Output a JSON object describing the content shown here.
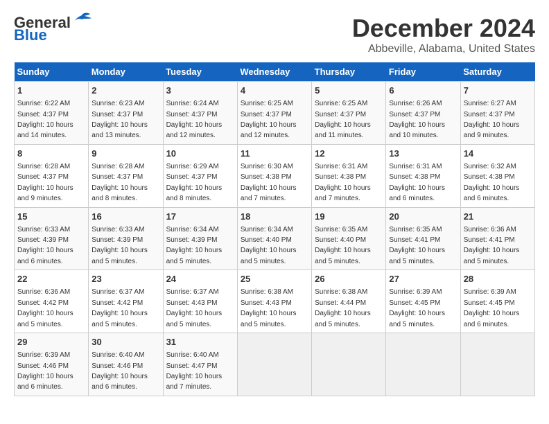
{
  "logo": {
    "general": "General",
    "blue": "Blue"
  },
  "title": "December 2024",
  "subtitle": "Abbeville, Alabama, United States",
  "days_header": [
    "Sunday",
    "Monday",
    "Tuesday",
    "Wednesday",
    "Thursday",
    "Friday",
    "Saturday"
  ],
  "weeks": [
    [
      {
        "day": "1",
        "sunrise": "6:22 AM",
        "sunset": "4:37 PM",
        "daylight": "10 hours and 14 minutes."
      },
      {
        "day": "2",
        "sunrise": "6:23 AM",
        "sunset": "4:37 PM",
        "daylight": "10 hours and 13 minutes."
      },
      {
        "day": "3",
        "sunrise": "6:24 AM",
        "sunset": "4:37 PM",
        "daylight": "10 hours and 12 minutes."
      },
      {
        "day": "4",
        "sunrise": "6:25 AM",
        "sunset": "4:37 PM",
        "daylight": "10 hours and 12 minutes."
      },
      {
        "day": "5",
        "sunrise": "6:25 AM",
        "sunset": "4:37 PM",
        "daylight": "10 hours and 11 minutes."
      },
      {
        "day": "6",
        "sunrise": "6:26 AM",
        "sunset": "4:37 PM",
        "daylight": "10 hours and 10 minutes."
      },
      {
        "day": "7",
        "sunrise": "6:27 AM",
        "sunset": "4:37 PM",
        "daylight": "10 hours and 9 minutes."
      }
    ],
    [
      {
        "day": "8",
        "sunrise": "6:28 AM",
        "sunset": "4:37 PM",
        "daylight": "10 hours and 9 minutes."
      },
      {
        "day": "9",
        "sunrise": "6:28 AM",
        "sunset": "4:37 PM",
        "daylight": "10 hours and 8 minutes."
      },
      {
        "day": "10",
        "sunrise": "6:29 AM",
        "sunset": "4:37 PM",
        "daylight": "10 hours and 8 minutes."
      },
      {
        "day": "11",
        "sunrise": "6:30 AM",
        "sunset": "4:38 PM",
        "daylight": "10 hours and 7 minutes."
      },
      {
        "day": "12",
        "sunrise": "6:31 AM",
        "sunset": "4:38 PM",
        "daylight": "10 hours and 7 minutes."
      },
      {
        "day": "13",
        "sunrise": "6:31 AM",
        "sunset": "4:38 PM",
        "daylight": "10 hours and 6 minutes."
      },
      {
        "day": "14",
        "sunrise": "6:32 AM",
        "sunset": "4:38 PM",
        "daylight": "10 hours and 6 minutes."
      }
    ],
    [
      {
        "day": "15",
        "sunrise": "6:33 AM",
        "sunset": "4:39 PM",
        "daylight": "10 hours and 6 minutes."
      },
      {
        "day": "16",
        "sunrise": "6:33 AM",
        "sunset": "4:39 PM",
        "daylight": "10 hours and 5 minutes."
      },
      {
        "day": "17",
        "sunrise": "6:34 AM",
        "sunset": "4:39 PM",
        "daylight": "10 hours and 5 minutes."
      },
      {
        "day": "18",
        "sunrise": "6:34 AM",
        "sunset": "4:40 PM",
        "daylight": "10 hours and 5 minutes."
      },
      {
        "day": "19",
        "sunrise": "6:35 AM",
        "sunset": "4:40 PM",
        "daylight": "10 hours and 5 minutes."
      },
      {
        "day": "20",
        "sunrise": "6:35 AM",
        "sunset": "4:41 PM",
        "daylight": "10 hours and 5 minutes."
      },
      {
        "day": "21",
        "sunrise": "6:36 AM",
        "sunset": "4:41 PM",
        "daylight": "10 hours and 5 minutes."
      }
    ],
    [
      {
        "day": "22",
        "sunrise": "6:36 AM",
        "sunset": "4:42 PM",
        "daylight": "10 hours and 5 minutes."
      },
      {
        "day": "23",
        "sunrise": "6:37 AM",
        "sunset": "4:42 PM",
        "daylight": "10 hours and 5 minutes."
      },
      {
        "day": "24",
        "sunrise": "6:37 AM",
        "sunset": "4:43 PM",
        "daylight": "10 hours and 5 minutes."
      },
      {
        "day": "25",
        "sunrise": "6:38 AM",
        "sunset": "4:43 PM",
        "daylight": "10 hours and 5 minutes."
      },
      {
        "day": "26",
        "sunrise": "6:38 AM",
        "sunset": "4:44 PM",
        "daylight": "10 hours and 5 minutes."
      },
      {
        "day": "27",
        "sunrise": "6:39 AM",
        "sunset": "4:45 PM",
        "daylight": "10 hours and 5 minutes."
      },
      {
        "day": "28",
        "sunrise": "6:39 AM",
        "sunset": "4:45 PM",
        "daylight": "10 hours and 6 minutes."
      }
    ],
    [
      {
        "day": "29",
        "sunrise": "6:39 AM",
        "sunset": "4:46 PM",
        "daylight": "10 hours and 6 minutes."
      },
      {
        "day": "30",
        "sunrise": "6:40 AM",
        "sunset": "4:46 PM",
        "daylight": "10 hours and 6 minutes."
      },
      {
        "day": "31",
        "sunrise": "6:40 AM",
        "sunset": "4:47 PM",
        "daylight": "10 hours and 7 minutes."
      },
      null,
      null,
      null,
      null
    ]
  ],
  "labels": {
    "sunrise": "Sunrise:",
    "sunset": "Sunset:",
    "daylight": "Daylight:"
  }
}
